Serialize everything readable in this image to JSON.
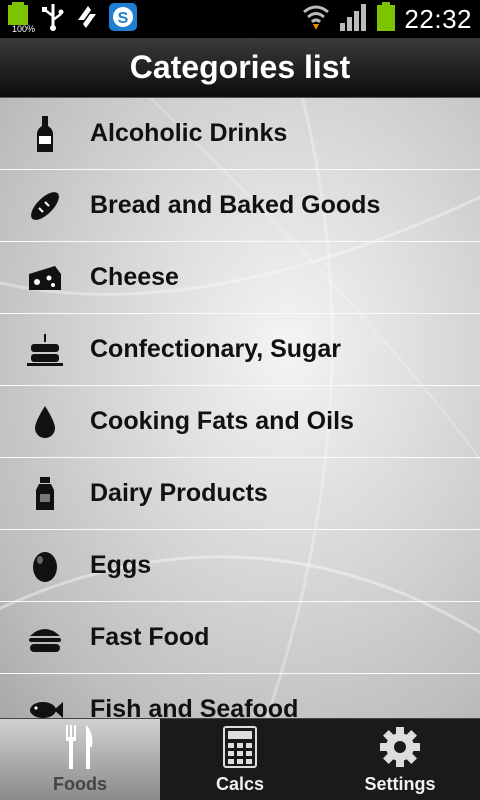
{
  "statusbar": {
    "battery_percent": "100%",
    "time": "22:32",
    "icons": [
      "battery-icon",
      "usb-icon",
      "usb-debug-icon",
      "skype-icon",
      "wifi-icon",
      "signal-icon",
      "battery-full-icon"
    ]
  },
  "header": {
    "title": "Categories list"
  },
  "categories": [
    {
      "label": "Alcoholic Drinks",
      "icon": "bottle-icon"
    },
    {
      "label": "Bread and Baked Goods",
      "icon": "bread-icon"
    },
    {
      "label": "Cheese",
      "icon": "cheese-icon"
    },
    {
      "label": "Confectionary, Sugar",
      "icon": "cake-icon"
    },
    {
      "label": "Cooking Fats and Oils",
      "icon": "oil-drop-icon"
    },
    {
      "label": "Dairy Products",
      "icon": "milk-icon"
    },
    {
      "label": "Eggs",
      "icon": "egg-icon"
    },
    {
      "label": "Fast Food",
      "icon": "burger-icon"
    },
    {
      "label": "Fish and Seafood",
      "icon": "fish-icon"
    }
  ],
  "tabs": [
    {
      "label": "Foods",
      "icon": "fork-knife-icon",
      "active": true
    },
    {
      "label": "Calcs",
      "icon": "calculator-icon",
      "active": false
    },
    {
      "label": "Settings",
      "icon": "gear-icon",
      "active": false
    }
  ],
  "colors": {
    "accent_green": "#7cc400",
    "skype_blue": "#1e7fd4"
  }
}
